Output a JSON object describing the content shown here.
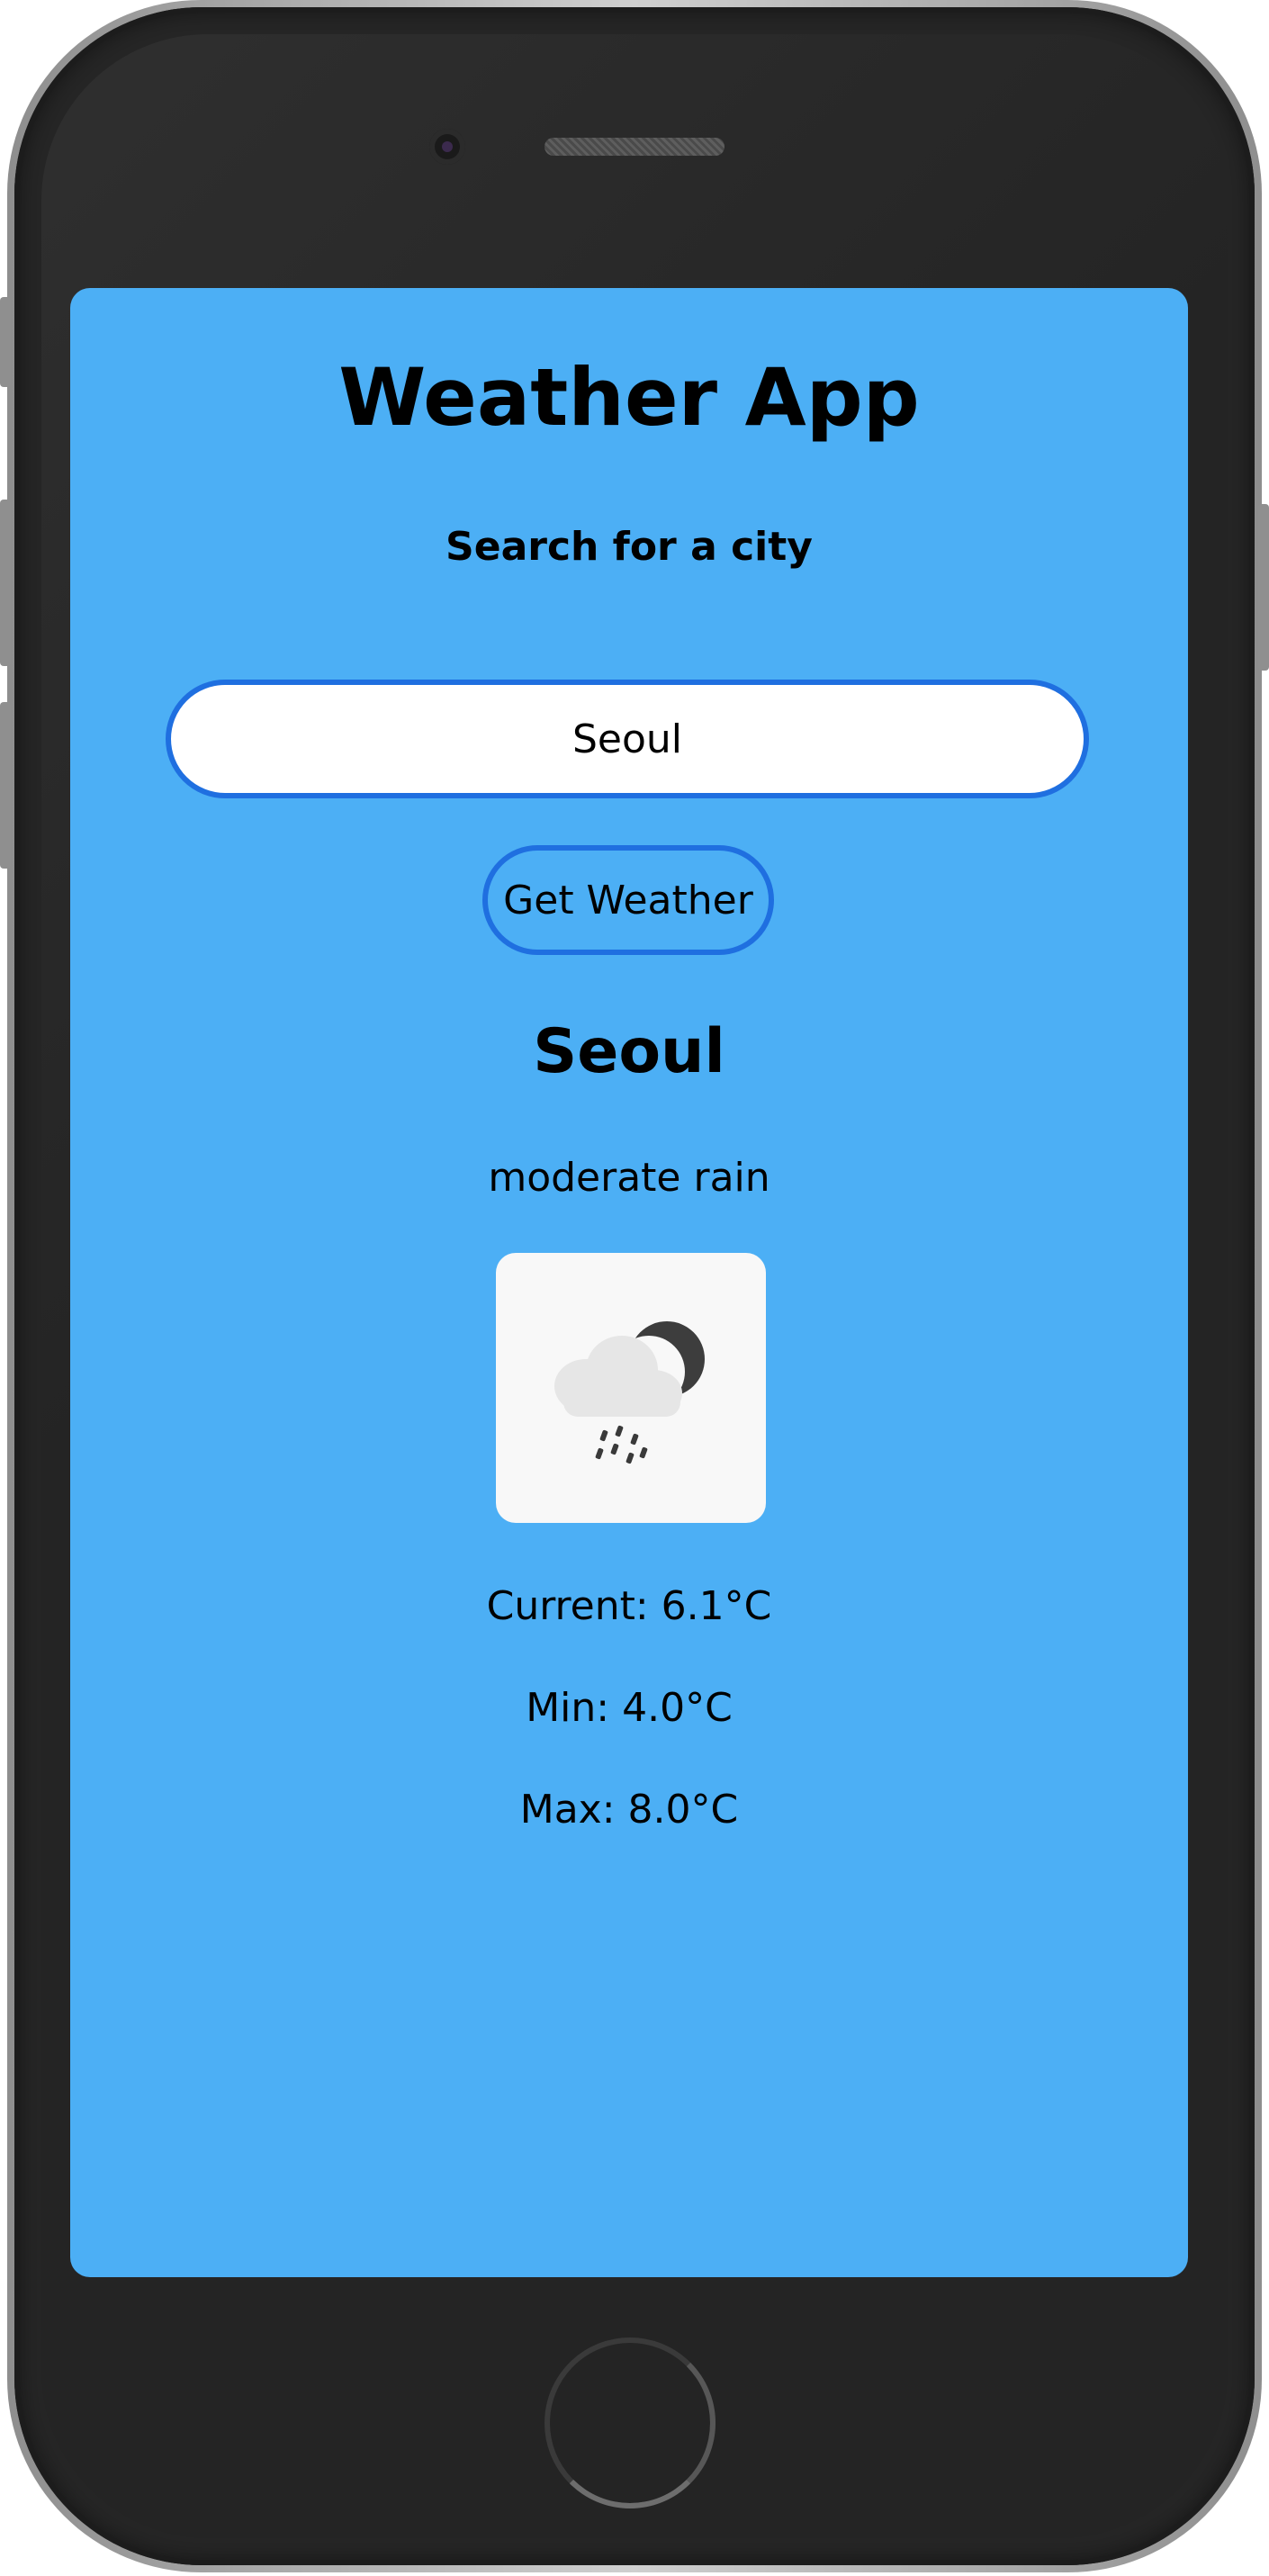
{
  "app": {
    "title": "Weather App",
    "subtitle": "Search for a city"
  },
  "search": {
    "value": "Seoul"
  },
  "actions": {
    "get_weather_label": "Get Weather"
  },
  "weather": {
    "city": "Seoul",
    "description": "moderate rain",
    "icon": "moon-cloud-rain-icon",
    "current": "Current: 6.1°C",
    "min": "Min: 4.0°C",
    "max": "Max: 8.0°C"
  },
  "colors": {
    "screen_background": "#4caff5",
    "accent_border": "#1f6fe0",
    "device_body": "#262626"
  }
}
